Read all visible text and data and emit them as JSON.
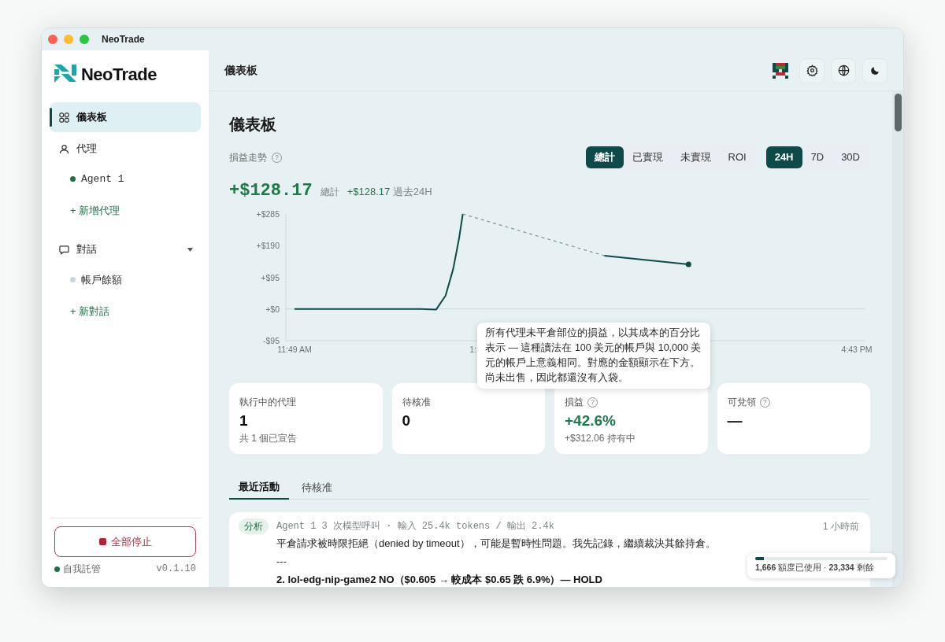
{
  "window": {
    "title": "NeoTrade"
  },
  "sidebar": {
    "logo": "NeoTrade",
    "items": [
      {
        "kind": "nav",
        "label": "儀表板",
        "selected": true
      },
      {
        "kind": "nav",
        "label": "代理",
        "selected": false
      },
      {
        "kind": "agent",
        "label": "Agent 1",
        "color": "#1f6e4a"
      },
      {
        "kind": "add",
        "label": "+ 新增代理"
      },
      {
        "kind": "nav",
        "label": "對話",
        "selected": false,
        "expanded": true
      },
      {
        "kind": "chat",
        "label": "帳戶餘額",
        "color": "#c8d6d9"
      },
      {
        "kind": "add",
        "label": "+ 新對話"
      }
    ],
    "stop_button": "全部停止",
    "mode": {
      "label": "自我託管",
      "color": "#1f6e4a"
    },
    "version": "v0.1.10"
  },
  "header": {
    "title": "儀表板"
  },
  "page_title": "儀表板",
  "pnl": {
    "label": "損益走勢",
    "help": "?",
    "metric_tabs": [
      {
        "label": "總計",
        "selected": true
      },
      {
        "label": "已實現",
        "selected": false
      },
      {
        "label": "未實現",
        "selected": false
      },
      {
        "label": "ROI",
        "selected": false
      }
    ],
    "range_tabs": [
      {
        "label": "24H",
        "selected": true
      },
      {
        "label": "7D",
        "selected": false
      },
      {
        "label": "30D",
        "selected": false
      }
    ],
    "total": "+$128.17",
    "total_label": "總計",
    "change": "+$128.17",
    "change_label": "過去24H",
    "chart_data": {
      "type": "line",
      "x": [
        709,
        775,
        783,
        788,
        792,
        795,
        797,
        871,
        915
      ],
      "xlim": [
        704.5,
        1007.5
      ],
      "ylim": [
        -95,
        285
      ],
      "xticks": [
        {
          "value": 709,
          "label": "11:49 AM"
        },
        {
          "value": 1003,
          "label": "4:43 PM"
        }
      ],
      "yticks": [
        {
          "value": 285,
          "label": "+$285"
        },
        {
          "value": 190,
          "label": "+$190"
        },
        {
          "value": 95,
          "label": "+$95"
        },
        {
          "value": 0,
          "label": "+$0"
        },
        {
          "value": -95,
          "label": "-$95"
        }
      ],
      "series": [
        {
          "color": "#0e4a48",
          "line_style": "solid",
          "values": [
            0,
            0,
            -2,
            40,
            120,
            210,
            285,
            null,
            null
          ]
        },
        {
          "color": "#8a9698",
          "line_style": "dashed",
          "values": [
            null,
            null,
            null,
            null,
            null,
            null,
            285,
            160,
            null
          ]
        },
        {
          "color": "#0e4a48",
          "line_style": "solid",
          "values": [
            null,
            null,
            null,
            null,
            null,
            null,
            null,
            160,
            134
          ]
        }
      ]
    },
    "x_label_partial": "1:"
  },
  "tooltip": "所有代理未平倉部位的損益，以其成本的百分比表示 — 這種讀法在 100 美元的帳戶與 10,000 美元的帳戶上意義相同。對應的金額顯示在下方。尚未出售，因此都還沒有入袋。",
  "stats": [
    {
      "label": "執行中的代理",
      "value": "1",
      "color": "#111111",
      "note": "共 1 個已宣告"
    },
    {
      "label": "待核准",
      "value": "0",
      "color": "#111111"
    },
    {
      "label": "損益",
      "help": "?",
      "value": "+42.6%",
      "color": "#1f7a4a",
      "note": "+$312.06 持有中"
    },
    {
      "label": "可兌領",
      "help": "?",
      "value": "—",
      "color": "#111111"
    }
  ],
  "activity_tabs": [
    {
      "label": "最近活動",
      "selected": true
    },
    {
      "label": "待核准",
      "selected": false
    }
  ],
  "activity": [
    {
      "badge": "分析",
      "meta": "Agent 1 3 次模型呼叫 · 輸入 25.4k tokens / 輸出 2.4k",
      "time": "1 小時前",
      "lines": [
        {
          "kind": "text",
          "text": "平倉請求被時限拒絕（denied by timeout），可能是暫時性問題。我先記錄，繼續裁決其餘持倉。"
        },
        {
          "kind": "text",
          "text": "---"
        },
        {
          "kind": "bold",
          "text": "2. lol-edg-nip-game2 NO（$0.605 → 較成本 $0.65 跌 6.9%）— HOLD"
        }
      ]
    }
  ],
  "usage": {
    "level": 0.067,
    "text": "**1,666** 額度已使用 · **23,334** 剩餘"
  }
}
